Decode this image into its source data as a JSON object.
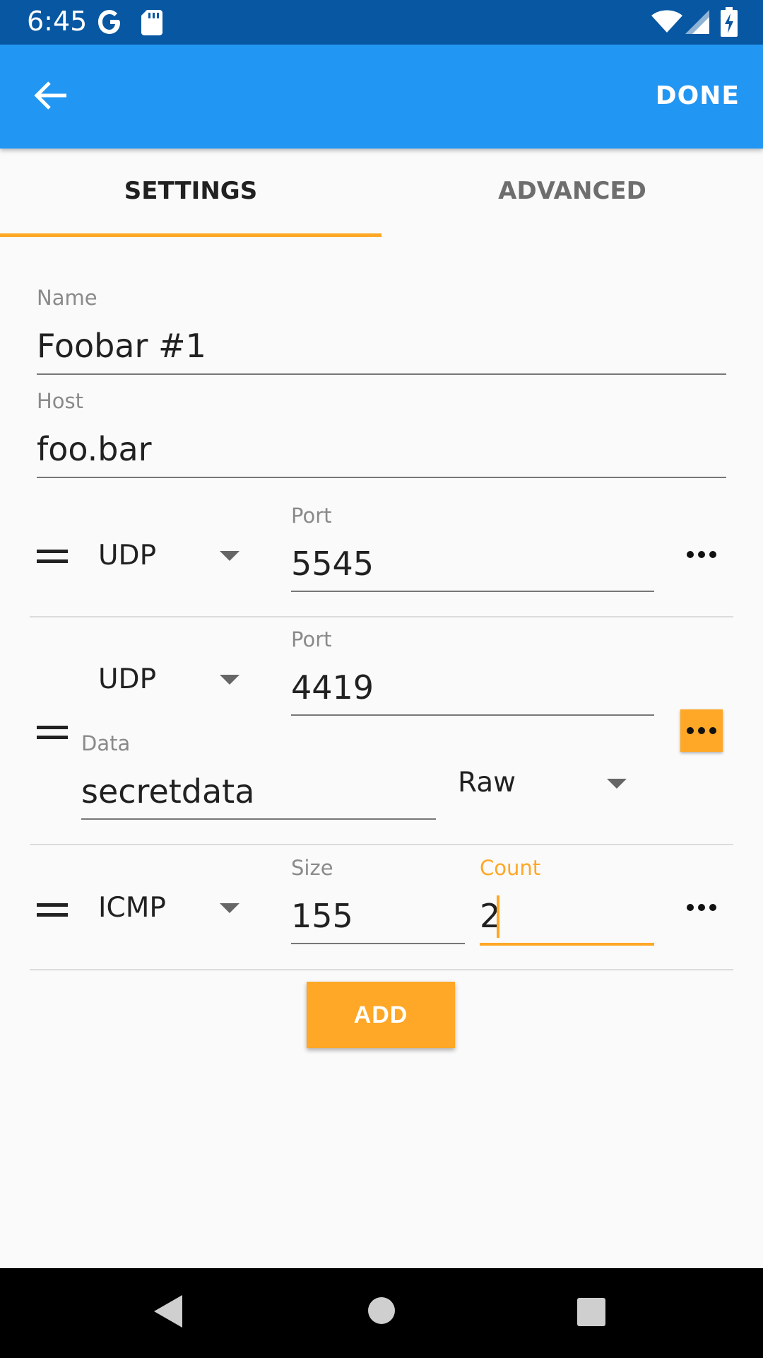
{
  "status_bar": {
    "time": "6:45"
  },
  "app_bar": {
    "done_label": "DONE"
  },
  "tabs": [
    {
      "label": "SETTINGS"
    },
    {
      "label": "ADVANCED"
    }
  ],
  "form": {
    "name": {
      "label": "Name",
      "value": "Foobar #1"
    },
    "host": {
      "label": "Host",
      "value": "foo.bar"
    }
  },
  "probes": [
    {
      "protocol": "UDP",
      "port_label": "Port",
      "port": "5545"
    },
    {
      "protocol": "UDP",
      "port_label": "Port",
      "port": "4419",
      "data_label": "Data",
      "data": "secretdata",
      "encoding": "Raw"
    },
    {
      "protocol": "ICMP",
      "size_label": "Size",
      "size": "155",
      "count_label": "Count",
      "count": "2"
    }
  ],
  "add_label": "ADD",
  "colors": {
    "app_bar": "#2296f3",
    "status_bar": "#0757a2",
    "accent": "#ffa726"
  }
}
